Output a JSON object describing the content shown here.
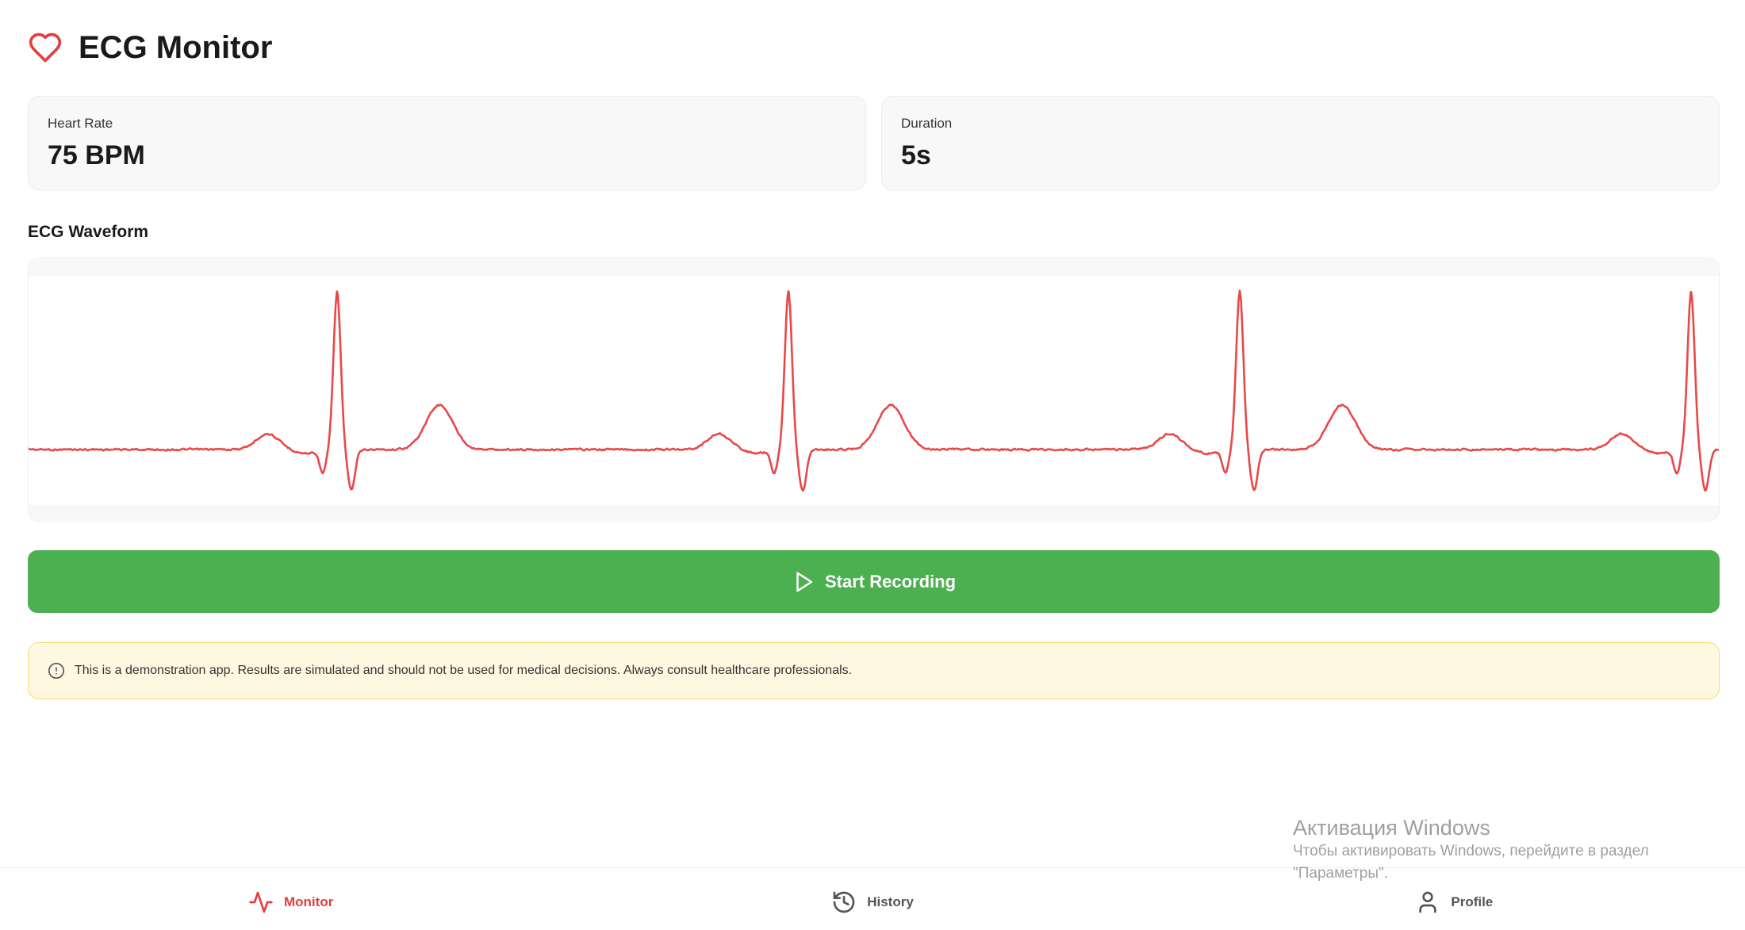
{
  "colors": {
    "accent": "#E53E3E",
    "trace": "#E84848",
    "button": "#4CAF50",
    "warning_bg": "#FFF8E1",
    "warning_border": "#F2DA75",
    "muted": "#555555"
  },
  "header": {
    "icon": "heart-icon",
    "title": "ECG Monitor"
  },
  "stats": [
    {
      "label": "Heart Rate",
      "value": "75 BPM"
    },
    {
      "label": "Duration",
      "value": "5s"
    }
  ],
  "waveform": {
    "title": "ECG Waveform"
  },
  "record_button": {
    "icon": "play-icon",
    "label": "Start Recording"
  },
  "disclaimer": {
    "icon": "alert-circle-icon",
    "text": "This is a demonstration app. Results are simulated and should not be used for medical decisions. Always consult healthcare professionals."
  },
  "nav": {
    "items": [
      {
        "icon": "activity-icon",
        "label": "Monitor",
        "active": true
      },
      {
        "icon": "history-icon",
        "label": "History",
        "active": false
      },
      {
        "icon": "user-icon",
        "label": "Profile",
        "active": false
      }
    ]
  },
  "os_watermark": {
    "title": "Активация Windows",
    "line1": "Чтобы активировать Windows, перейдите в раздел",
    "line2": "\"Параметры\"."
  }
}
